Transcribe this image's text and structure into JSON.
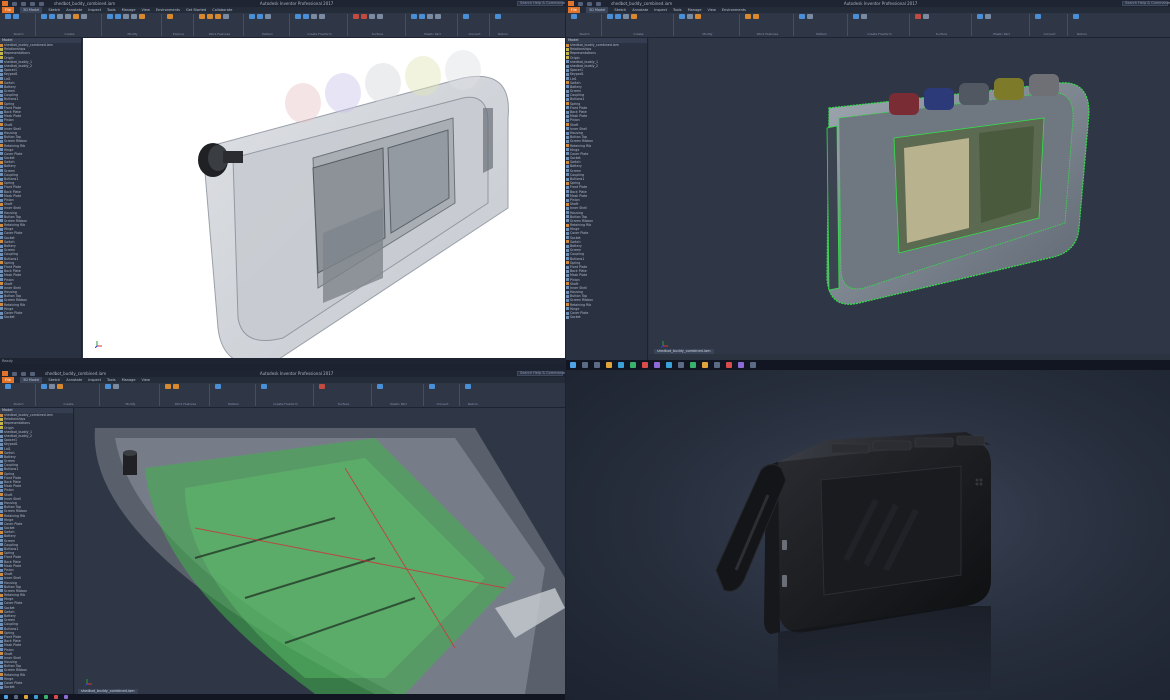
{
  "app": {
    "name": "Autodesk Inventor Professional 2017",
    "document": "shedbot_buddy_combined.iam",
    "search_placeholder": "Search Help & Commands..."
  },
  "menu": {
    "file": "File",
    "tabs": [
      "3D Model",
      "Sketch",
      "Annotate",
      "Inspect",
      "Tools",
      "Manage",
      "View",
      "Environments",
      "Get Started",
      "Collaborate",
      "Vault"
    ],
    "active": "3D Model"
  },
  "ribbon": {
    "groups": [
      "Sketch",
      "Create",
      "Modify",
      "Explore",
      "Work Features",
      "Pattern",
      "Create Freeform",
      "Surface",
      "Plastic Part",
      "Harness",
      "Convert",
      "3D Print",
      "Return"
    ]
  },
  "browser": {
    "tabs": [
      "Model",
      "Favorites"
    ],
    "top_items": [
      "shedbot_buddy_combined.iam",
      "Relationships",
      "Representations",
      "Origin",
      "shedbot_buddy_1",
      "shedbot_buddy_2",
      "Spacer1",
      "Keypad1",
      "Lid1"
    ],
    "items": [
      "Switch",
      "Battery",
      "Screen",
      "Coupling",
      "Buttons1",
      "Spring",
      "Front Plate",
      "Back Plate",
      "Mask Plate",
      "Pinion",
      "Shaft",
      "Inner Shell",
      "Housing",
      "Button Top",
      "Screen Ribbon",
      "Retaining Rib",
      "Hinge",
      "Cover Plate",
      "Socket"
    ]
  },
  "status": {
    "ready": "Ready",
    "doc_tab": "shedbot_buddy_combined.iam"
  },
  "colors": {
    "accent": "#e2732b",
    "select_green": "#34e04a",
    "viewport_white": "#ffffff",
    "viewport_dark": "#2f3746"
  },
  "taskbar": {
    "icons": [
      "windows-icon",
      "cortana-icon",
      "task-view-icon",
      "explorer-icon",
      "edge-icon",
      "chrome-icon",
      "inventor-icon",
      "photoshop-icon",
      "mail-icon"
    ]
  }
}
